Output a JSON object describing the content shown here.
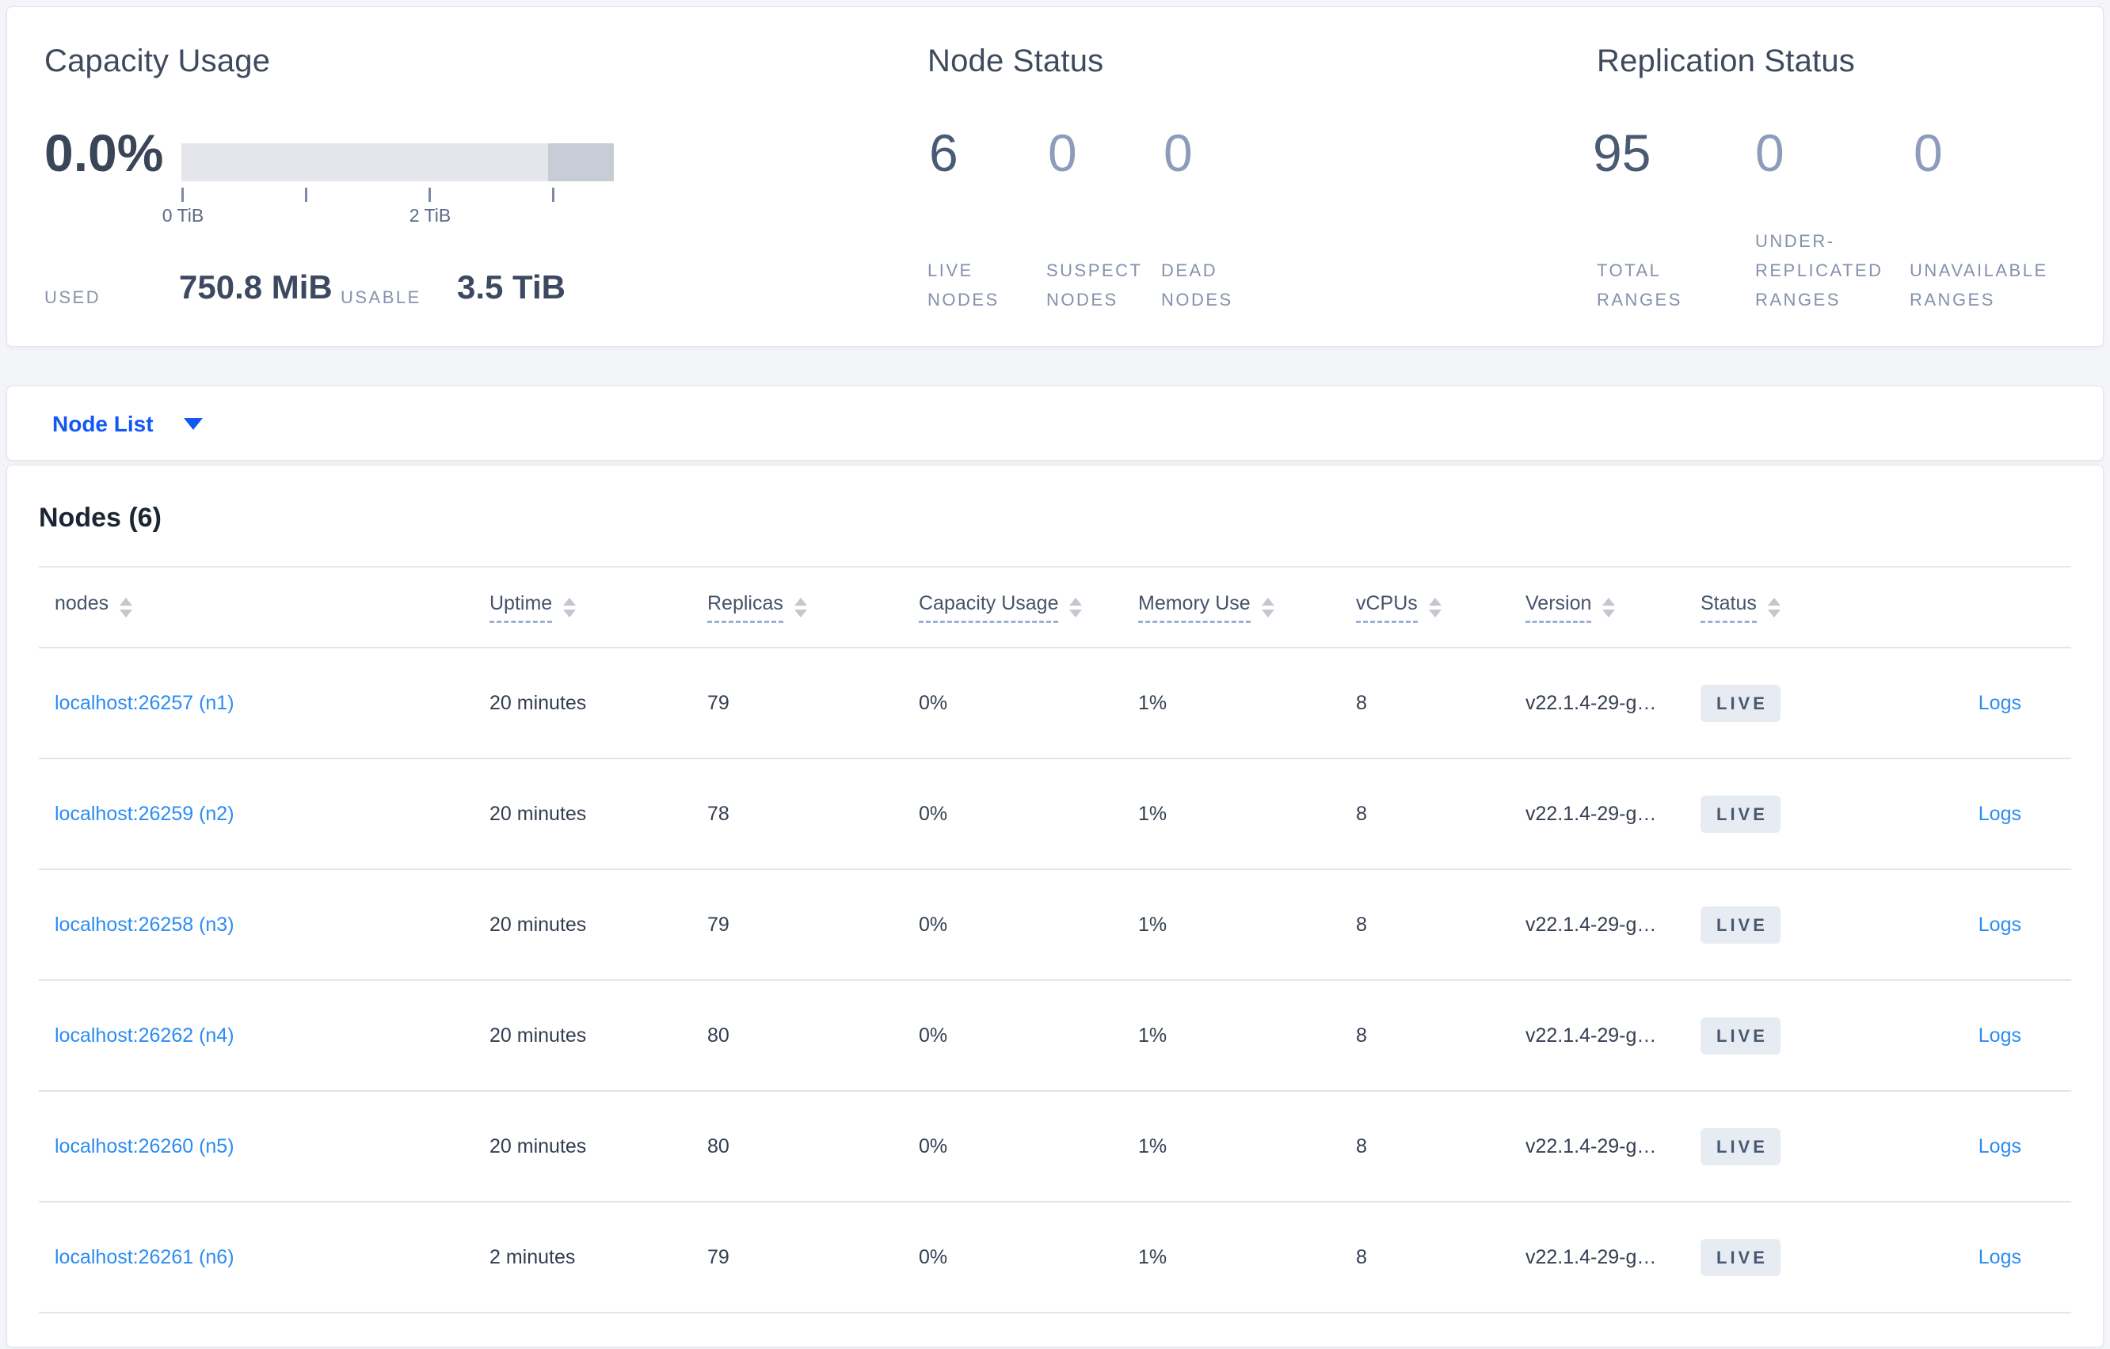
{
  "summary": {
    "capacity": {
      "title": "Capacity Usage",
      "percent": "0.0%",
      "tick_labels": [
        "0 TiB",
        "2 TiB"
      ],
      "used_label": "USED",
      "used_value": "750.8 MiB",
      "usable_label": "USABLE",
      "usable_value": "3.5 TiB"
    },
    "node_status": {
      "title": "Node Status",
      "stats": [
        {
          "value": "6",
          "emphasis": "dark",
          "label_lines": [
            "LIVE",
            "NODES"
          ]
        },
        {
          "value": "0",
          "emphasis": "light",
          "label_lines": [
            "SUSPECT",
            "NODES"
          ]
        },
        {
          "value": "0",
          "emphasis": "light",
          "label_lines": [
            "DEAD",
            "NODES"
          ]
        }
      ]
    },
    "replication_status": {
      "title": "Replication Status",
      "stats": [
        {
          "value": "95",
          "emphasis": "dark",
          "label_lines": [
            "TOTAL",
            "RANGES"
          ]
        },
        {
          "value": "0",
          "emphasis": "light",
          "label_lines": [
            "UNDER-",
            "REPLICATED",
            "RANGES"
          ]
        },
        {
          "value": "0",
          "emphasis": "light",
          "label_lines": [
            "UNAVAILABLE",
            "RANGES"
          ]
        }
      ]
    }
  },
  "view_selector": {
    "label": "Node List"
  },
  "table": {
    "title": "Nodes (6)",
    "columns": [
      {
        "label": "nodes",
        "sortable": true,
        "underlined": false
      },
      {
        "label": "Uptime",
        "sortable": true,
        "underlined": true
      },
      {
        "label": "Replicas",
        "sortable": true,
        "underlined": true
      },
      {
        "label": "Capacity Usage",
        "sortable": true,
        "underlined": true
      },
      {
        "label": "Memory Use",
        "sortable": true,
        "underlined": true
      },
      {
        "label": "vCPUs",
        "sortable": true,
        "underlined": true
      },
      {
        "label": "Version",
        "sortable": true,
        "underlined": true
      },
      {
        "label": "Status",
        "sortable": true,
        "underlined": true
      }
    ],
    "logs_label": "Logs",
    "rows": [
      {
        "node": "localhost:26257 (n1)",
        "uptime": "20 minutes",
        "replicas": "79",
        "capacity_usage": "0%",
        "memory_use": "1%",
        "vcpus": "8",
        "version": "v22.1.4-29-g…",
        "status": "LIVE",
        "logs": "Logs"
      },
      {
        "node": "localhost:26259 (n2)",
        "uptime": "20 minutes",
        "replicas": "78",
        "capacity_usage": "0%",
        "memory_use": "1%",
        "vcpus": "8",
        "version": "v22.1.4-29-g…",
        "status": "LIVE",
        "logs": "Logs"
      },
      {
        "node": "localhost:26258 (n3)",
        "uptime": "20 minutes",
        "replicas": "79",
        "capacity_usage": "0%",
        "memory_use": "1%",
        "vcpus": "8",
        "version": "v22.1.4-29-g…",
        "status": "LIVE",
        "logs": "Logs"
      },
      {
        "node": "localhost:26262 (n4)",
        "uptime": "20 minutes",
        "replicas": "80",
        "capacity_usage": "0%",
        "memory_use": "1%",
        "vcpus": "8",
        "version": "v22.1.4-29-g…",
        "status": "LIVE",
        "logs": "Logs"
      },
      {
        "node": "localhost:26260 (n5)",
        "uptime": "20 minutes",
        "replicas": "80",
        "capacity_usage": "0%",
        "memory_use": "1%",
        "vcpus": "8",
        "version": "v22.1.4-29-g…",
        "status": "LIVE",
        "logs": "Logs"
      },
      {
        "node": "localhost:26261 (n6)",
        "uptime": "2 minutes",
        "replicas": "79",
        "capacity_usage": "0%",
        "memory_use": "1%",
        "vcpus": "8",
        "version": "v22.1.4-29-g…",
        "status": "LIVE",
        "logs": "Logs"
      }
    ]
  },
  "colors": {
    "page_background": "#f4f5f9",
    "card_background": "#ffffff",
    "accent_blue": "#1357f4",
    "link_blue": "#2b8cf2",
    "stat_dark": "#4a5a73",
    "stat_light": "#8e9bba",
    "label_gray": "#8591ab",
    "bar_light": "#e5e6ec",
    "bar_dark": "#c7ccd6",
    "badge_background": "#e7ebf2",
    "badge_text": "#475872"
  }
}
